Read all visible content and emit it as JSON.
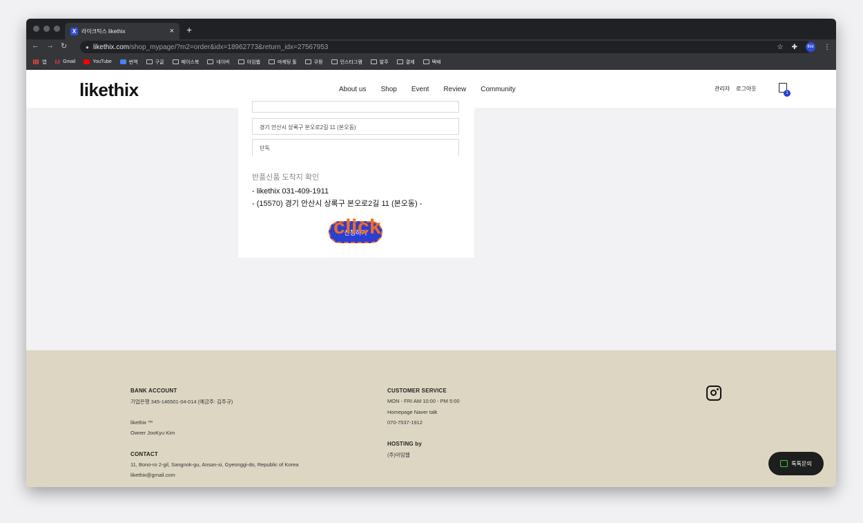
{
  "browser": {
    "tab_title": "라이크틱스 likethix",
    "tab_favicon": "X",
    "tab_close": "×",
    "new_tab": "+",
    "url_host": "likethix.com",
    "url_path": "/shop_mypage/?m2=order&idx=18962773&return_idx=27567953",
    "extension_label": "thix",
    "bookmarks": [
      {
        "label": "앱",
        "icon": "apps-grid-icon"
      },
      {
        "label": "Gmail",
        "icon": "gmail-icon"
      },
      {
        "label": "YouTube",
        "icon": "youtube-icon"
      },
      {
        "label": "번역",
        "icon": "translate-icon"
      },
      {
        "label": "구글",
        "icon": "folder-icon"
      },
      {
        "label": "페이스북",
        "icon": "folder-icon"
      },
      {
        "label": "네이버",
        "icon": "folder-icon"
      },
      {
        "label": "아임웹",
        "icon": "folder-icon"
      },
      {
        "label": "마케팅 툴",
        "icon": "folder-icon"
      },
      {
        "label": "쿠팡",
        "icon": "folder-icon"
      },
      {
        "label": "인스타그램",
        "icon": "folder-icon"
      },
      {
        "label": "발주",
        "icon": "folder-icon"
      },
      {
        "label": "결제",
        "icon": "folder-icon"
      },
      {
        "label": "택배",
        "icon": "folder-icon"
      }
    ]
  },
  "site": {
    "logo": "likethix",
    "nav": [
      "About us",
      "Shop",
      "Event",
      "Review",
      "Community"
    ],
    "user_nav": [
      "관리자",
      "로그아웃"
    ],
    "cart_count": "1"
  },
  "form": {
    "address": "경기 안산시 상록구 본오로2길 11 (본오동)",
    "detail": "단독",
    "section_title": "반품신품 도착지 확인",
    "return_line1": "- likethix 031-409-1911",
    "return_line2": "- (15570) 경기 안산시 상록구 본오로2길 11 (본오동) -",
    "apply_button": "신청하기"
  },
  "annotation": {
    "click_label": "click",
    "highlight_color": "#ff6a1f"
  },
  "footer": {
    "bank_heading": "BANK ACCOUNT",
    "bank_info": "기업은행 345-146501-04-014 (예금주: 김주규)",
    "brand": "likethix ™",
    "owner": "Owner JooKyu Kim",
    "contact_heading": "CONTACT",
    "contact_address": "11, Bono-ro 2-gil, Sangnok-gu, Ansan-si, Gyeonggi-do, Republic of Korea",
    "contact_email": "likethix@gmail.com",
    "cs_heading": "CUSTOMER SERVICE",
    "cs_hours": "MON - FRI AM 10:00 - PM 5:00",
    "cs_talk": "Homepage Naver talk",
    "cs_phone": "070-7537-1912",
    "hosting_heading": "HOSTING by",
    "hosting_company": "(주)아임웹",
    "chat_button": "톡톡문의"
  },
  "colors": {
    "brand_blue": "#2b3fd1",
    "footer_bg": "#dcd6c3",
    "click_orange": "#f26b21"
  }
}
